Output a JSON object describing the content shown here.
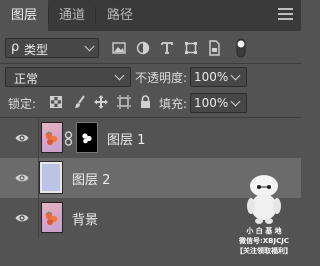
{
  "tabs": [
    {
      "label": "图层",
      "active": true
    },
    {
      "label": "通道",
      "active": false
    },
    {
      "label": "路径",
      "active": false
    }
  ],
  "filter": {
    "search_glyph": "ρ",
    "kind_label": "类型",
    "icons": [
      "image-filter-icon",
      "adjustment-filter-icon",
      "type-filter-icon",
      "shape-filter-icon",
      "smart-object-filter-icon",
      "filter-toggle-icon"
    ]
  },
  "blend": {
    "mode": "正常",
    "opacity_label": "不透明度:",
    "opacity_value": "100%"
  },
  "lock": {
    "label": "锁定:",
    "fill_label": "填充:",
    "fill_value": "100%"
  },
  "layers": [
    {
      "name": "图层 1",
      "visible": true,
      "selected": false,
      "has_mask": true
    },
    {
      "name": "图层 2",
      "visible": true,
      "selected": true,
      "has_mask": false
    },
    {
      "name": "背景",
      "visible": true,
      "selected": false,
      "has_mask": false
    }
  ],
  "watermark": {
    "line1": "小 白 基 地",
    "line2": "微信号:XBJCJC",
    "line3": "【关注领取福利】"
  },
  "colors": {
    "panel_bg": "#535353",
    "tab_bar_bg": "#3a3a3a",
    "selected_row": "#6b6b6b",
    "field_bg": "#474747"
  }
}
